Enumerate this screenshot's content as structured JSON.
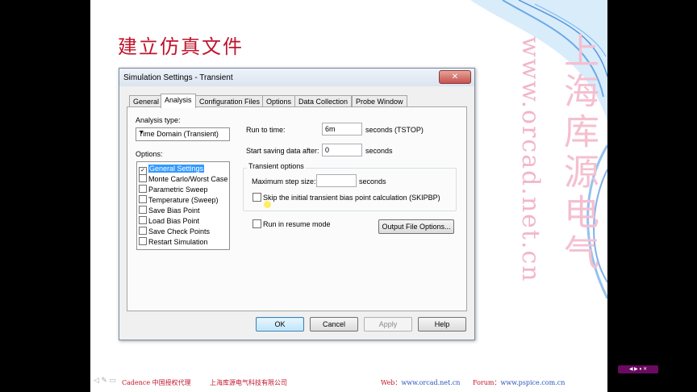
{
  "slide": {
    "title": "建立仿真文件",
    "watermark_url": "www.orcad.net.cn",
    "watermark_cn": "上海库源电气",
    "footer": {
      "left": "Cadence 中国授权代理",
      "company": "上海库源电气科技有限公司",
      "web_label": "Web：",
      "web_url": "www.orcad.net.cn",
      "forum_label": "Forum：",
      "forum_url": "www.pspice.com.cn"
    }
  },
  "dialog": {
    "title": "Simulation Settings - Transient",
    "close_glyph": "✕",
    "tabs": [
      "General",
      "Analysis",
      "Configuration Files",
      "Options",
      "Data Collection",
      "Probe Window"
    ],
    "active_tab": "Analysis",
    "analysis_type_label": "Analysis type:",
    "analysis_type_value": "Time Domain (Transient)",
    "options_label": "Options:",
    "options": [
      {
        "label": "General Settings",
        "checked": true,
        "selected": true
      },
      {
        "label": "Monte Carlo/Worst Case",
        "checked": false,
        "selected": false
      },
      {
        "label": "Parametric Sweep",
        "checked": false,
        "selected": false
      },
      {
        "label": "Temperature (Sweep)",
        "checked": false,
        "selected": false
      },
      {
        "label": "Save Bias Point",
        "checked": false,
        "selected": false
      },
      {
        "label": "Load Bias Point",
        "checked": false,
        "selected": false
      },
      {
        "label": "Save Check Points",
        "checked": false,
        "selected": false
      },
      {
        "label": "Restart Simulation",
        "checked": false,
        "selected": false
      }
    ],
    "run_to_time_label": "Run to time:",
    "run_to_time_value": "6m",
    "run_to_time_unit": "seconds  (TSTOP)",
    "start_saving_label": "Start saving data after:",
    "start_saving_value": "0",
    "start_saving_unit": "seconds",
    "transient_group_label": "Transient options",
    "max_step_label": "Maximum step size:",
    "max_step_value": "",
    "max_step_unit": "seconds",
    "skip_bias_label": "Skip the initial transient bias point calculation  (SKIPBP)",
    "skip_bias_checked": false,
    "resume_label": "Run in resume mode",
    "resume_checked": false,
    "output_file_button": "Output File Options...",
    "buttons": {
      "ok": "OK",
      "cancel": "Cancel",
      "apply": "Apply",
      "help": "Help"
    }
  }
}
